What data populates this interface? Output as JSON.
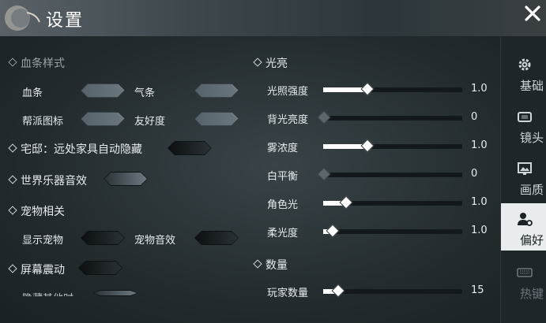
{
  "window": {
    "title": "设置",
    "close_label": "✕"
  },
  "left": {
    "health_bar_style": {
      "heading": "血条样式",
      "items": [
        {
          "label": "血条",
          "state": "disabled"
        },
        {
          "label": "气条",
          "state": "disabled"
        },
        {
          "label": "帮派图标",
          "state": "disabled"
        },
        {
          "label": "友好度",
          "state": "disabled"
        }
      ]
    },
    "house_hide": {
      "label": "宅邸：远处家具自动隐藏",
      "state": "off"
    },
    "music_sfx": {
      "label": "世界乐器音效",
      "state": "on"
    },
    "pet": {
      "heading": "宠物相关",
      "items": [
        {
          "label": "显示宠物",
          "state": "off"
        },
        {
          "label": "宠物音效",
          "state": "off"
        }
      ]
    },
    "screen_shake": {
      "label": "屏幕震动",
      "state": "off"
    },
    "partial_label": "隐藏其他时"
  },
  "right": {
    "light": {
      "heading": "光亮",
      "sliders": [
        {
          "label": "光照强度",
          "value": "1.0",
          "fraction": 0.31,
          "enabled": true
        },
        {
          "label": "背光亮度",
          "value": "0",
          "fraction": 0.0,
          "enabled": false
        },
        {
          "label": "雾浓度",
          "value": "1.0",
          "fraction": 0.31,
          "enabled": true
        },
        {
          "label": "白平衡",
          "value": "0",
          "fraction": 0.0,
          "enabled": false
        },
        {
          "label": "角色光",
          "value": "1.0",
          "fraction": 0.16,
          "enabled": true
        },
        {
          "label": "柔光度",
          "value": "1.0",
          "fraction": 0.06,
          "enabled": true
        }
      ]
    },
    "count": {
      "heading": "数量",
      "sliders": [
        {
          "label": "玩家数量",
          "value": "15",
          "fraction": 0.1,
          "enabled": true
        }
      ]
    }
  },
  "sidebar": {
    "tabs": [
      {
        "label": "基础",
        "icon": "gear-icon"
      },
      {
        "label": "镜头",
        "icon": "camera-icon"
      },
      {
        "label": "画质",
        "icon": "picture-icon"
      },
      {
        "label": "偏好",
        "icon": "user-settings-icon",
        "active": true
      },
      {
        "label": "热键",
        "icon": "keyboard-icon"
      }
    ]
  },
  "colors": {
    "accent_active_tab": "#e8ecee",
    "background": "#1d2528"
  }
}
